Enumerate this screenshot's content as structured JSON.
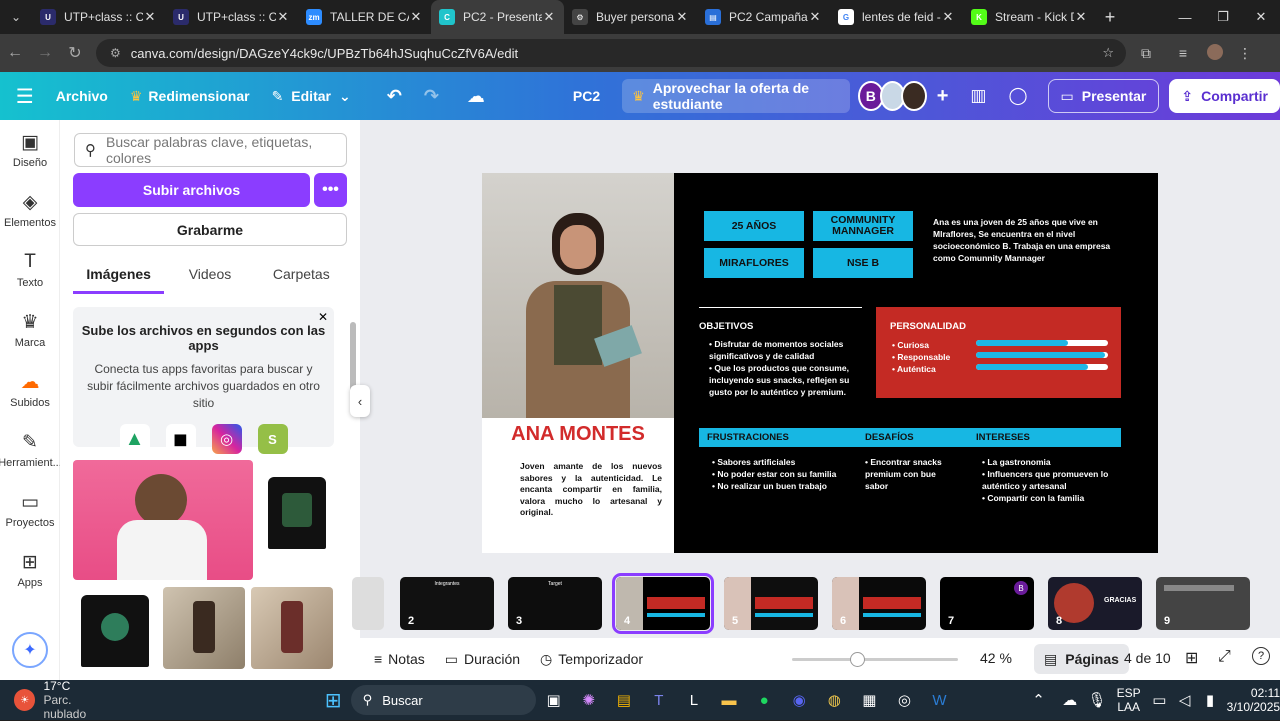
{
  "browser": {
    "tabs": [
      {
        "title": "UTP+class :: Cur",
        "color": "#2b2b6b",
        "glyph": "U"
      },
      {
        "title": "UTP+class :: Cur",
        "color": "#2b2b6b",
        "glyph": "U"
      },
      {
        "title": "TALLER DE CAMI",
        "color": "#2d8cff",
        "glyph": "zm"
      },
      {
        "title": "PC2 - Presentaci",
        "color": "#20c4cb",
        "glyph": "C",
        "active": true
      },
      {
        "title": "Buyer persona g",
        "color": "#444444",
        "glyph": "⚙"
      },
      {
        "title": "PC2 Campañas",
        "color": "#2a6fd8",
        "glyph": "▤"
      },
      {
        "title": "lentes de feid - B",
        "color": "#ffffff",
        "glyph": "G"
      },
      {
        "title": "Stream - Kick Da",
        "color": "#53fc18",
        "glyph": "K"
      }
    ],
    "url": "canva.com/design/DAGzeY4ck9c/UPBzTb64hJSuqhuCcZfV6A/edit"
  },
  "toolbar": {
    "file": "Archivo",
    "resize": "Redimensionar",
    "edit": "Editar",
    "doc_title": "PC2",
    "promo": "Aprovechar la oferta de estudiante",
    "avatar_b": "B",
    "present": "Presentar",
    "share": "Compartir"
  },
  "rail": [
    {
      "label": "Diseño",
      "icon": "▣"
    },
    {
      "label": "Elementos",
      "icon": "◈"
    },
    {
      "label": "Texto",
      "icon": "T"
    },
    {
      "label": "Marca",
      "icon": "♛"
    },
    {
      "label": "Subidos",
      "icon": "☁",
      "active": true
    },
    {
      "label": "Herramient...",
      "icon": "✎"
    },
    {
      "label": "Proyectos",
      "icon": "▭"
    },
    {
      "label": "Apps",
      "icon": "⊞"
    }
  ],
  "panel": {
    "search_placeholder": "Buscar palabras clave, etiquetas, colores",
    "upload": "Subir archivos",
    "record": "Grabarme",
    "tabs": [
      "Imágenes",
      "Videos",
      "Carpetas"
    ],
    "promo_title": "Sube los archivos en segundos con las apps",
    "promo_text": "Conecta tus apps favoritas para buscar y subir fácilmente archivos guardados en otro sitio"
  },
  "slide": {
    "chips": [
      "25 AÑOS",
      "COMMUNITY MANNAGER",
      "MIRAFLORES",
      "NSE B"
    ],
    "description": "Ana es una joven de 25 años que vive en Mlraflores, Se encuentra en el nivel socioeconómico B. Trabaja en una empresa como Comunnity Mannager",
    "name": "ANA MONTES",
    "bio": "Joven amante de los nuevos sabores y la autenticidad. Le encanta compartir en familia, valora mucho lo artesanal y original.",
    "objectives_title": "OBJETIVOS",
    "objectives": [
      "Disfrutar de momentos sociales significativos y de calidad",
      "Que los productos que consume, incluyendo sus snacks, reflejen su gusto por lo auténtico y premium."
    ],
    "personality_title": "PERSONALIDAD",
    "personality": [
      {
        "trait": "Curiosa",
        "level": 0.7
      },
      {
        "trait": "Responsable",
        "level": 0.98
      },
      {
        "trait": "Auténtica",
        "level": 0.85
      }
    ],
    "frustrations_title": "FRUSTRACIONES",
    "frustrations": [
      "Sabores artificiales",
      "No poder estar con su familia",
      "No realizar un buen trabajo"
    ],
    "challenges_title": "DESAFÍOS",
    "challenges": [
      "Encontrar snacks premium con bue sabor"
    ],
    "interests_title": "INTERESES",
    "interests": [
      "La gastronomia",
      "Influencers que promueven lo auténtico y artesanal",
      "Compartir con la familia"
    ]
  },
  "filmstrip": {
    "pages": [
      "2",
      "3",
      "4",
      "5",
      "6",
      "7",
      "8",
      "9"
    ],
    "selected": "4",
    "thumb_texts": [
      "Integrantes",
      "Target",
      "GRACIAS",
      "B"
    ]
  },
  "bottom": {
    "notes": "Notas",
    "duration": "Duración",
    "timer": "Temporizador",
    "zoom": "42 %",
    "pages": "Páginas",
    "page_count": "4 de 10"
  },
  "taskbar": {
    "temp": "17°C",
    "weather": "Parc. nublado",
    "search": "Buscar",
    "lang": "ESP",
    "lang2": "LAA",
    "time": "02:11",
    "date": "3/10/2025"
  }
}
